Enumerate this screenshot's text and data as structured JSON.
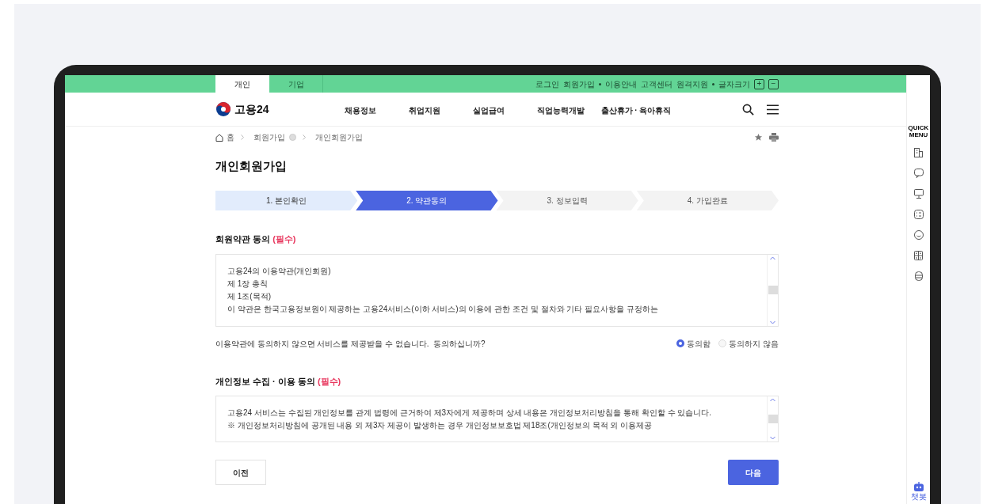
{
  "top_tabs": [
    {
      "label": "개인",
      "selected": true
    },
    {
      "label": "기업",
      "selected": false
    }
  ],
  "utility_links": [
    {
      "label": "로그인",
      "dot_after": false
    },
    {
      "label": "회원가입",
      "dot_after": true
    },
    {
      "label": "이용안내",
      "dot_after": false
    },
    {
      "label": "고객센터",
      "dot_after": false
    },
    {
      "label": "원격지원",
      "dot_after": true
    },
    {
      "label": "글자크기",
      "dot_after": false
    }
  ],
  "font_size_buttons": [
    "+",
    "−"
  ],
  "logo": "고용24",
  "nav": [
    "채용정보",
    "취업지원",
    "실업급여",
    "직업능력개발",
    "출산휴가 · 육아휴직"
  ],
  "breadcrumb": [
    "홈",
    "회원가입",
    "개인회원가입"
  ],
  "page_title": "개인회원가입",
  "steps": [
    {
      "label": "1. 본인확인",
      "completed": true,
      "selected": false
    },
    {
      "label": "2. 약관동의",
      "completed": false,
      "selected": true
    },
    {
      "label": "3. 정보입력",
      "completed": false,
      "selected": false
    },
    {
      "label": "4. 가입완료",
      "completed": false,
      "selected": false
    }
  ],
  "sections": [
    {
      "title": "회원약관 동의",
      "required": "(필수)",
      "lines": [
        "고용24의 이용약관(개인회원)",
        "제 1장 총칙",
        "제 1조(목적)",
        "이 약관은 한국고용정보원이 제공하는 고용24서비스(이하 서비스)의 이용에 관한 조건 및 절차와 기타 필요사항을 규정하는"
      ],
      "question": "이용약관에 동의하지 않으면 서비스를 제공받을 수 없습니다.  동의하십니까?",
      "options": [
        {
          "label": "동의함",
          "selected": true
        },
        {
          "label": "동의하지 않음",
          "selected": false
        }
      ]
    },
    {
      "title": "개인정보 수집 · 이용 동의",
      "required": "(필수)",
      "lines": [
        "고용24 서비스는 수집된 개인정보를 관계 법령에 근거하여 제3자에게 제공하며 상세 내용은 개인정보처리방침을 통해 확인할 수 있습니다.",
        "※ 개인정보처리방침에 공개된 내용 외 제3자 제공이 발생하는 경우 개인정보보호법 제18조(개인정보의 목적 외 이용제공"
      ]
    }
  ],
  "buttons": {
    "prev": "이전",
    "next": "다음"
  },
  "quick_menu": {
    "title": "QUICK MENU",
    "chatbot_label": "챗봇"
  }
}
